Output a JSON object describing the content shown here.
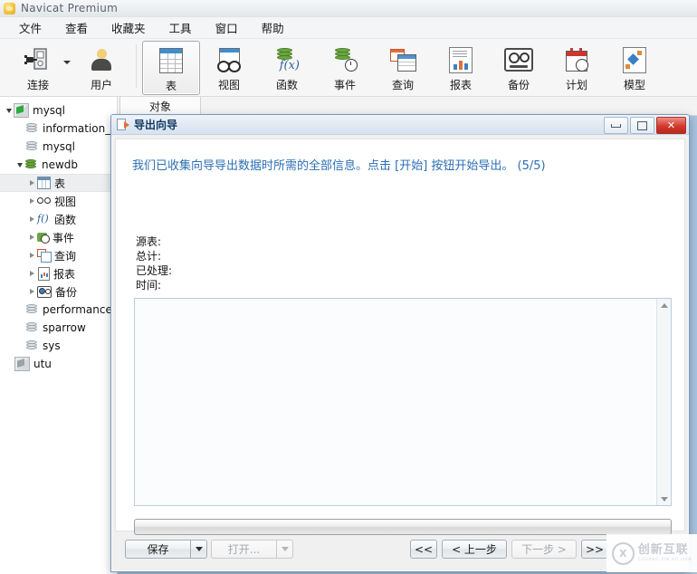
{
  "window": {
    "title": "Navicat Premium",
    "logo_icon": "navicat-logo-icon"
  },
  "menubar": {
    "items": [
      {
        "label": "文件"
      },
      {
        "label": "查看"
      },
      {
        "label": "收藏夹"
      },
      {
        "label": "工具"
      },
      {
        "label": "窗口"
      },
      {
        "label": "帮助"
      }
    ]
  },
  "toolbar": {
    "items": [
      {
        "label": "连接",
        "icon": "connection-icon",
        "has_dropdown": true,
        "selected": false
      },
      {
        "label": "用户",
        "icon": "user-icon",
        "has_dropdown": false,
        "selected": false
      },
      {
        "label": "表",
        "icon": "table-icon",
        "has_dropdown": false,
        "selected": true
      },
      {
        "label": "视图",
        "icon": "view-icon",
        "has_dropdown": false,
        "selected": false
      },
      {
        "label": "函数",
        "icon": "function-icon",
        "has_dropdown": false,
        "selected": false
      },
      {
        "label": "事件",
        "icon": "event-icon",
        "has_dropdown": false,
        "selected": false
      },
      {
        "label": "查询",
        "icon": "query-icon",
        "has_dropdown": false,
        "selected": false
      },
      {
        "label": "报表",
        "icon": "report-icon",
        "has_dropdown": false,
        "selected": false
      },
      {
        "label": "备份",
        "icon": "backup-icon",
        "has_dropdown": false,
        "selected": false
      },
      {
        "label": "计划",
        "icon": "schedule-icon",
        "has_dropdown": false,
        "selected": false
      },
      {
        "label": "模型",
        "icon": "model-icon",
        "has_dropdown": false,
        "selected": false
      }
    ]
  },
  "sidebar": {
    "nodes": [
      {
        "label": "mysql",
        "icon": "connection-green-icon",
        "indent": 0,
        "expander": "open",
        "highlighted": false
      },
      {
        "label": "information_",
        "icon": "database-icon",
        "indent": 1,
        "expander": "none",
        "highlighted": false
      },
      {
        "label": "mysql",
        "icon": "database-icon",
        "indent": 1,
        "expander": "none",
        "highlighted": false
      },
      {
        "label": "newdb",
        "icon": "database-green-icon",
        "indent": 1,
        "expander": "open",
        "highlighted": false
      },
      {
        "label": "表",
        "icon": "table-icon",
        "indent": 2,
        "expander": "closed",
        "highlighted": true
      },
      {
        "label": "视图",
        "icon": "view-icon",
        "indent": 2,
        "expander": "closed",
        "highlighted": false
      },
      {
        "label": "函数",
        "icon": "function-icon",
        "indent": 2,
        "expander": "closed",
        "highlighted": false
      },
      {
        "label": "事件",
        "icon": "event-icon",
        "indent": 2,
        "expander": "closed",
        "highlighted": false
      },
      {
        "label": "查询",
        "icon": "query-icon",
        "indent": 2,
        "expander": "closed",
        "highlighted": false
      },
      {
        "label": "报表",
        "icon": "report-icon",
        "indent": 2,
        "expander": "closed",
        "highlighted": false
      },
      {
        "label": "备份",
        "icon": "backup-icon",
        "indent": 2,
        "expander": "closed",
        "highlighted": false
      },
      {
        "label": "performance",
        "icon": "database-icon",
        "indent": 1,
        "expander": "none",
        "highlighted": false
      },
      {
        "label": "sparrow",
        "icon": "database-icon",
        "indent": 1,
        "expander": "none",
        "highlighted": false
      },
      {
        "label": "sys",
        "icon": "database-icon",
        "indent": 1,
        "expander": "none",
        "highlighted": false
      },
      {
        "label": "utu",
        "icon": "connection-gray-icon",
        "indent": 0,
        "expander": "none",
        "highlighted": false
      }
    ]
  },
  "main": {
    "tabs": [
      {
        "label": "对象",
        "active": true
      }
    ]
  },
  "dialog": {
    "title": "导出向导",
    "title_icon": "export-wizard-icon",
    "window_buttons": [
      {
        "name": "minimize",
        "glyph": "minimize-icon"
      },
      {
        "name": "maximize",
        "glyph": "maximize-icon"
      },
      {
        "name": "close",
        "glyph": "close-icon"
      }
    ],
    "hint": "我们已收集向导导出数据时所需的全部信息。点击 [开始] 按钮开始导出。 (5/5)",
    "hint_color": "#2c6fb5",
    "fields": [
      {
        "label": "源表:",
        "value": ""
      },
      {
        "label": "总计:",
        "value": ""
      },
      {
        "label": "已处理:",
        "value": ""
      },
      {
        "label": "时间:",
        "value": ""
      }
    ],
    "log": {
      "content": "",
      "scrollbar": {
        "up_icon": "scroll-up-icon",
        "down_icon": "scroll-down-icon"
      }
    },
    "progress": {
      "percent": 0
    },
    "buttons": {
      "save": {
        "label": "保存",
        "enabled": true,
        "has_dropdown": true
      },
      "open": {
        "label": "打开...",
        "enabled": false,
        "has_dropdown": true
      },
      "first": {
        "label": "<<",
        "enabled": true
      },
      "back": {
        "label": "< 上一步",
        "enabled": true
      },
      "next": {
        "label": "下一步 >",
        "enabled": false
      },
      "last": {
        "label": ">>",
        "enabled": true
      }
    }
  },
  "watermark": {
    "mark": "X",
    "primary": "创新互联",
    "secondary": "CHUANG XIN HU LIAN"
  }
}
